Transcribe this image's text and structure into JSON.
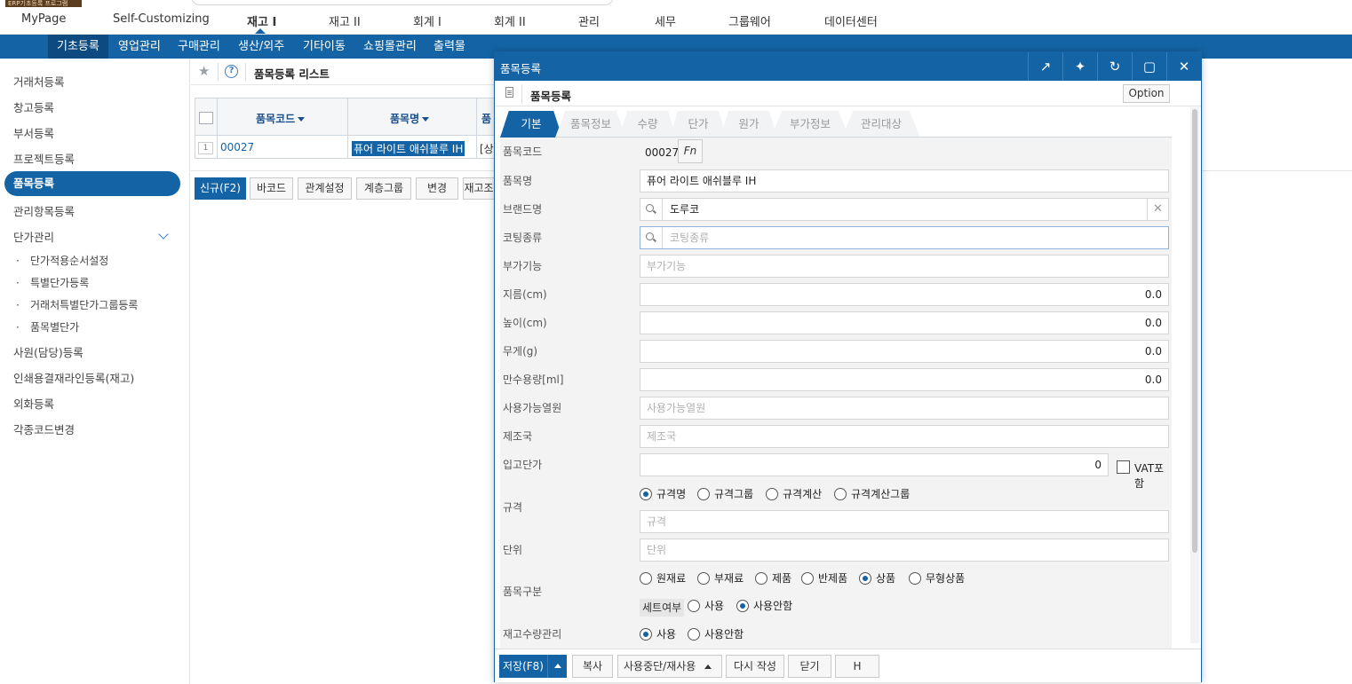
{
  "brand_tag": "ERP기초등록 프로그램",
  "top_tabs": [
    "MyPage",
    "Self-Customizing",
    "재고 I",
    "재고 II",
    "회계 I",
    "회계 II",
    "관리",
    "세무",
    "그룹웨어",
    "데이터센터"
  ],
  "sub_tabs": [
    "기초등록",
    "영업관리",
    "구매관리",
    "생산/외주",
    "기타이동",
    "쇼핑몰관리",
    "출력물"
  ],
  "sidebar": {
    "items": [
      "거래처등록",
      "창고등록",
      "부서등록",
      "프로젝트등록",
      "품목등록",
      "관리항목등록",
      "단가관리"
    ],
    "sub_items": [
      "단가적용순서설정",
      "특별단가등록",
      "거래처특별단가그룹등록",
      "품목별단가"
    ],
    "items2": [
      "사원(담당)등록",
      "인쇄용결재라인등록(재고)",
      "외화등록",
      "각종코드변경"
    ]
  },
  "list": {
    "title": "품목등록 리스트",
    "columns": [
      "품목코드",
      "품목명",
      "품"
    ],
    "row": {
      "num": "1",
      "code": "00027",
      "name": "퓨어 라이트 애쉬블루 IH",
      "extra": "[상"
    },
    "buttons": [
      "신규(F2)",
      "바코드",
      "관계설정",
      "계층그룹",
      "변경",
      "재고조"
    ]
  },
  "dialog": {
    "title": "품목등록",
    "sub_title": "품목등록",
    "option_label": "Option",
    "tabs": [
      "기본",
      "품목정보",
      "수량",
      "단가",
      "원가",
      "부가정보",
      "관리대상"
    ],
    "fields": {
      "code_label": "품목코드",
      "code_value": "00027",
      "fn_label": "Fn",
      "name_label": "품목명",
      "name_value": "퓨어 라이트 애쉬블루 IH",
      "brand_label": "브랜드명",
      "brand_value": "도루코",
      "coating_label": "코팅종류",
      "coating_placeholder": "코팅종류",
      "extra_label": "부가기능",
      "extra_placeholder": "부가기능",
      "diameter_label": "지름(cm)",
      "diameter_value": "0.0",
      "height_label": "높이(cm)",
      "height_value": "0.0",
      "weight_label": "무게(g)",
      "weight_value": "0.0",
      "capacity_label": "만수용량[ml]",
      "capacity_value": "0.0",
      "heat_label": "사용가능열원",
      "heat_placeholder": "사용가능열원",
      "country_label": "제조국",
      "country_placeholder": "제조국",
      "inprice_label": "입고단가",
      "inprice_value": "0",
      "vat_label": "VAT포함",
      "spec_label": "규격",
      "spec_options": [
        "규격명",
        "규격그룹",
        "규격계산",
        "규격계산그룹"
      ],
      "spec_placeholder": "규격",
      "unit_label": "단위",
      "unit_placeholder": "단위",
      "type_label": "품목구분",
      "type_options": [
        "원재료",
        "부재료",
        "제품",
        "반제품",
        "상품",
        "무형상품"
      ],
      "set_label": "세트여부",
      "set_options": [
        "사용",
        "사용안함"
      ],
      "stock_label": "재고수량관리",
      "stock_options": [
        "사용",
        "사용안함"
      ]
    },
    "footer": [
      "저장(F8)",
      "복사",
      "사용중단/재사용",
      "다시 작성",
      "닫기",
      "H"
    ]
  },
  "colors": {
    "primary": "#1464a5",
    "primary_dark": "#0c4a80"
  }
}
